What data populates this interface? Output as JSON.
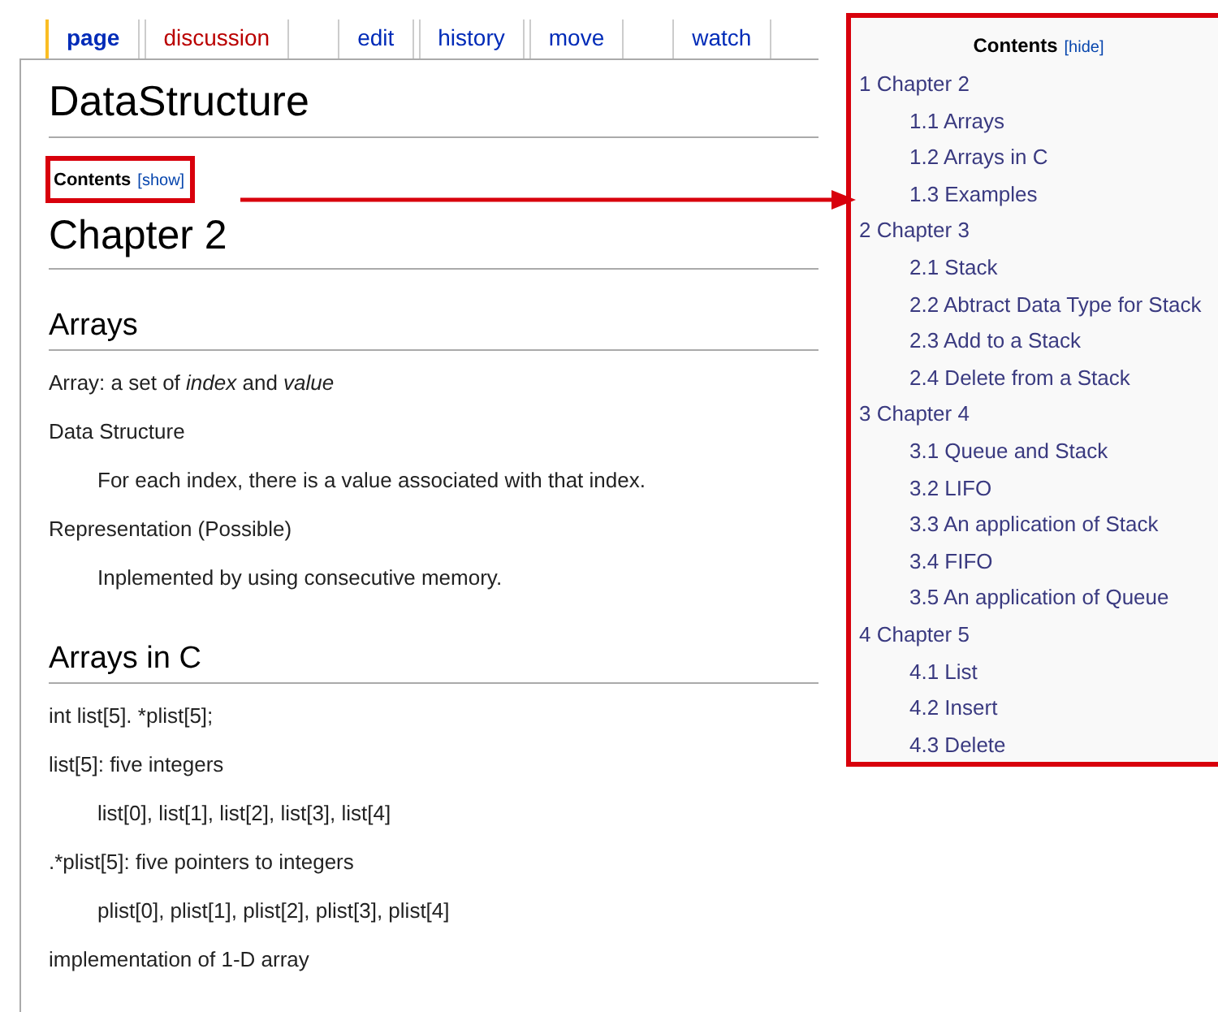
{
  "tabs": [
    {
      "label": "page",
      "selected": true,
      "missing": false
    },
    {
      "label": "discussion",
      "selected": false,
      "missing": true
    },
    {
      "label": "edit",
      "selected": false,
      "missing": false
    },
    {
      "label": "history",
      "selected": false,
      "missing": false
    },
    {
      "label": "move",
      "selected": false,
      "missing": false
    },
    {
      "label": "watch",
      "selected": false,
      "missing": false
    }
  ],
  "article": {
    "title": "DataStructure",
    "toc_collapsed": {
      "title": "Contents",
      "toggle": "[show]"
    },
    "blocks": [
      {
        "kind": "h1",
        "text": "Chapter 2"
      },
      {
        "kind": "h2",
        "text": "Arrays"
      },
      {
        "kind": "para",
        "text": "Array: a set of *index* and *value*"
      },
      {
        "kind": "para",
        "text": "Data Structure"
      },
      {
        "kind": "indent",
        "text": "For each index, there is a value associated with that index."
      },
      {
        "kind": "para",
        "text": "Representation (Possible)"
      },
      {
        "kind": "indent",
        "text": "Inplemented by using consecutive memory."
      },
      {
        "kind": "h2",
        "text": "Arrays in C"
      },
      {
        "kind": "para",
        "text": "int list[5]. *plist[5];"
      },
      {
        "kind": "para",
        "text": "list[5]: five integers"
      },
      {
        "kind": "indent",
        "text": "list[0], list[1], list[2], list[3], list[4]"
      },
      {
        "kind": "para",
        "text": ".*plist[5]: five pointers to integers"
      },
      {
        "kind": "indent",
        "text": "plist[0], plist[1], plist[2], plist[3], plist[4]"
      },
      {
        "kind": "para",
        "text": "implementation of 1-D array"
      }
    ]
  },
  "toc_expanded": {
    "title": "Contents",
    "toggle": "[hide]",
    "items": [
      {
        "text": "1 Chapter 2",
        "children": [
          {
            "text": "1.1 Arrays"
          },
          {
            "text": "1.2 Arrays in C"
          },
          {
            "text": "1.3 Examples"
          }
        ]
      },
      {
        "text": "2 Chapter 3",
        "children": [
          {
            "text": "2.1 Stack"
          },
          {
            "text": "2.2 Abtract Data Type for Stack"
          },
          {
            "text": "2.3 Add to a Stack"
          },
          {
            "text": "2.4 Delete from a Stack"
          }
        ]
      },
      {
        "text": "3 Chapter 4",
        "children": [
          {
            "text": "3.1 Queue and Stack"
          },
          {
            "text": "3.2 LIFO"
          },
          {
            "text": "3.3 An application of Stack"
          },
          {
            "text": "3.4 FIFO"
          },
          {
            "text": "3.5 An application of Queue"
          }
        ]
      },
      {
        "text": "4 Chapter 5",
        "children": [
          {
            "text": "4.1 List"
          },
          {
            "text": "4.2 Insert"
          },
          {
            "text": "4.3 Delete"
          }
        ]
      }
    ]
  }
}
